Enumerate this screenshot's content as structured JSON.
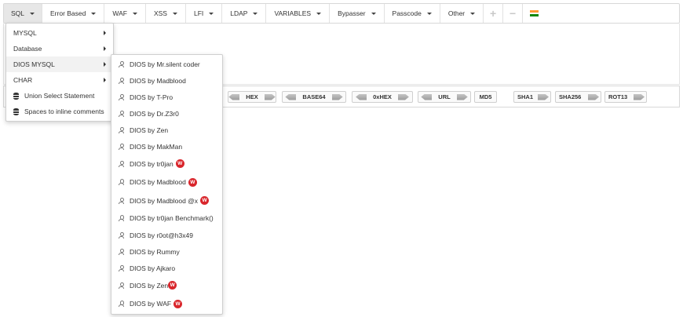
{
  "toolbar": {
    "items": [
      {
        "label": "SQL",
        "active": true
      },
      {
        "label": "Error Based"
      },
      {
        "label": "WAF"
      },
      {
        "label": "XSS"
      },
      {
        "label": "LFI"
      },
      {
        "label": "LDAP"
      },
      {
        "label": "VARIABLES"
      },
      {
        "label": "Bypasser"
      },
      {
        "label": "Passcode"
      },
      {
        "label": "Other"
      }
    ],
    "icons": [
      "plus-icon",
      "minus-icon",
      "india-flag-icon"
    ],
    "flag_colors": [
      "#ff9933",
      "#ffffff",
      "#138808"
    ]
  },
  "sql_menu": {
    "items": [
      {
        "label": "MYSQL",
        "submenu": true
      },
      {
        "label": "Database",
        "submenu": true
      },
      {
        "label": "DIOS MYSQL",
        "submenu": true
      },
      {
        "label": "CHAR",
        "submenu": true
      },
      {
        "label": "Union Select Statement",
        "icon": "database-icon"
      },
      {
        "label": "Spaces to inline comments",
        "icon": "database-icon"
      }
    ]
  },
  "dios_menu": {
    "items": [
      {
        "label": "DIOS by Mr.silent coder"
      },
      {
        "label": "DIOS by Madblood"
      },
      {
        "label": "DIOS by T-Pro"
      },
      {
        "label": "DIOS by Dr.Z3r0"
      },
      {
        "label": "DIOS by Zen"
      },
      {
        "label": "DIOS by MakMan"
      },
      {
        "label": "DIOS by tr0jan",
        "badge": "W"
      },
      {
        "label": "DIOS by Madblood",
        "badge": "W"
      },
      {
        "label": "DIOS by Madblood @x",
        "badge": "W"
      },
      {
        "label": "DIOS by tr0jan Benchmark()"
      },
      {
        "label": "DIOS by r0ot@h3x49"
      },
      {
        "label": "DIOS by Rummy"
      },
      {
        "label": "DIOS by Ajkaro"
      },
      {
        "label": "DIOS by Zen",
        "badge": "W"
      },
      {
        "label": "DIOS by WAF",
        "badge": "W"
      }
    ]
  },
  "encoders": {
    "buttons": [
      {
        "label": "HEX",
        "arrows": true
      },
      {
        "label": "BASE64",
        "arrows": true
      },
      {
        "label": "0xHEX",
        "arrows": true
      },
      {
        "label": "URL",
        "arrows": true
      },
      {
        "label": "MD5"
      },
      {
        "label": "SHA1"
      },
      {
        "label": "SHA256"
      },
      {
        "label": "ROT13",
        "right_arrow": true
      }
    ]
  }
}
